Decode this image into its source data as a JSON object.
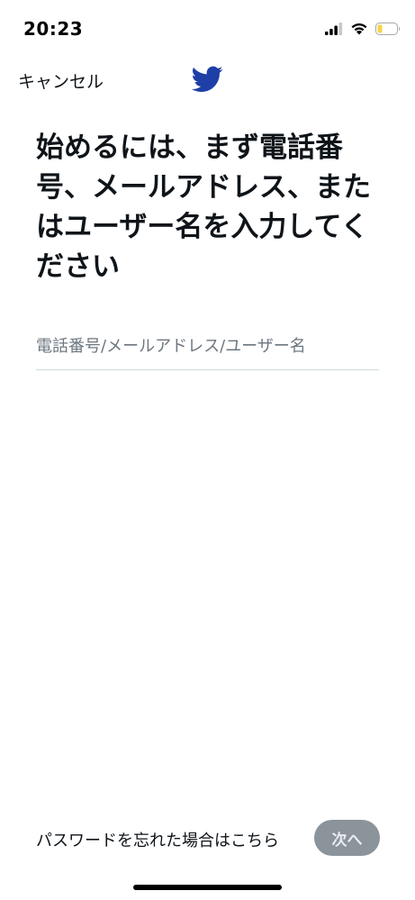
{
  "status_bar": {
    "time": "20:23",
    "signal_icon": "cellular-signal-icon",
    "wifi_icon": "wifi-icon",
    "battery_icon": "battery-icon",
    "battery_level": 0.25,
    "battery_color": "#f5d547"
  },
  "nav": {
    "cancel_label": "キャンセル",
    "logo_icon": "twitter-bird-icon",
    "logo_color": "#1d3fa6"
  },
  "main": {
    "title": "始めるには、まず電話番号、メールアドレス、またはユーザー名を入力してください",
    "input_placeholder": "電話番号/メールアドレス/ユーザー名",
    "input_value": ""
  },
  "footer": {
    "forgot_label": "パスワードを忘れた場合はこちら",
    "next_label": "次へ",
    "next_color": "#8b939b"
  }
}
